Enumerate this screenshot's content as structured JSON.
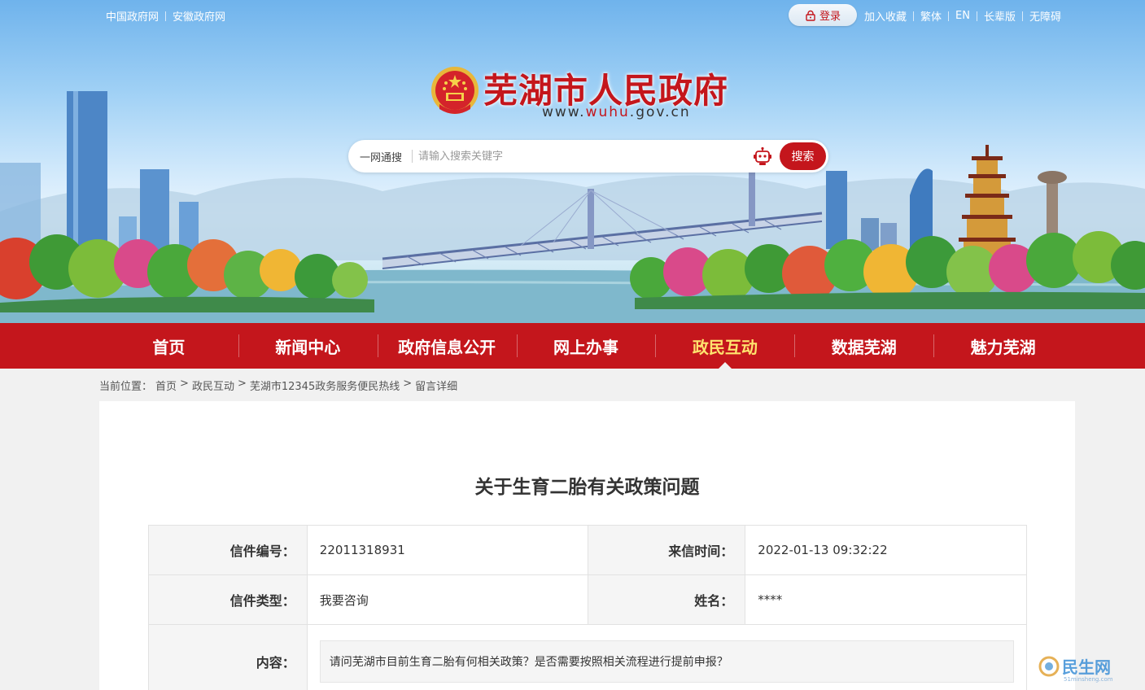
{
  "top_links_left": [
    "中国政府网",
    "安徽政府网"
  ],
  "login": {
    "label": "登录",
    "icon": "lock-icon"
  },
  "top_links_right": [
    "加入收藏",
    "繁体",
    "EN",
    "长辈版",
    "无障碍"
  ],
  "site": {
    "title": "芜湖市人民政府",
    "domain_prefix": "www.",
    "domain_mid": "wuhu",
    "domain_suffix": ".gov.cn"
  },
  "search": {
    "scope": "一网通搜",
    "placeholder": "请输入搜索关键字",
    "button": "搜索",
    "assistant_icon": "robot-icon"
  },
  "nav": [
    {
      "label": "首页",
      "active": false
    },
    {
      "label": "新闻中心",
      "active": false
    },
    {
      "label": "政府信息公开",
      "active": false
    },
    {
      "label": "网上办事",
      "active": false
    },
    {
      "label": "政民互动",
      "active": true
    },
    {
      "label": "数据芜湖",
      "active": false
    },
    {
      "label": "魅力芜湖",
      "active": false
    }
  ],
  "breadcrumb": {
    "prefix": "当前位置：",
    "items": [
      "首页",
      "政民互动",
      "芜湖市12345政务服务便民热线",
      "留言详细"
    ],
    "separator": ">"
  },
  "message": {
    "title": "关于生育二胎有关政策问题",
    "labels": {
      "id": "信件编号：",
      "time": "来信时间：",
      "type": "信件类型：",
      "name": "姓名：",
      "content": "内容："
    },
    "id": "22011318931",
    "time": "2022-01-13 09:32:22",
    "type": "我要咨询",
    "name": "****",
    "content": "请问芜湖市目前生育二胎有何相关政策？是否需要按照相关流程进行提前申报？"
  },
  "colors": {
    "primary_red": "#c4161c",
    "active_nav": "#ffe36e",
    "page_bg": "#f1f1f1"
  },
  "watermark": {
    "text": "民生网",
    "sub": "51minsheng.com"
  }
}
